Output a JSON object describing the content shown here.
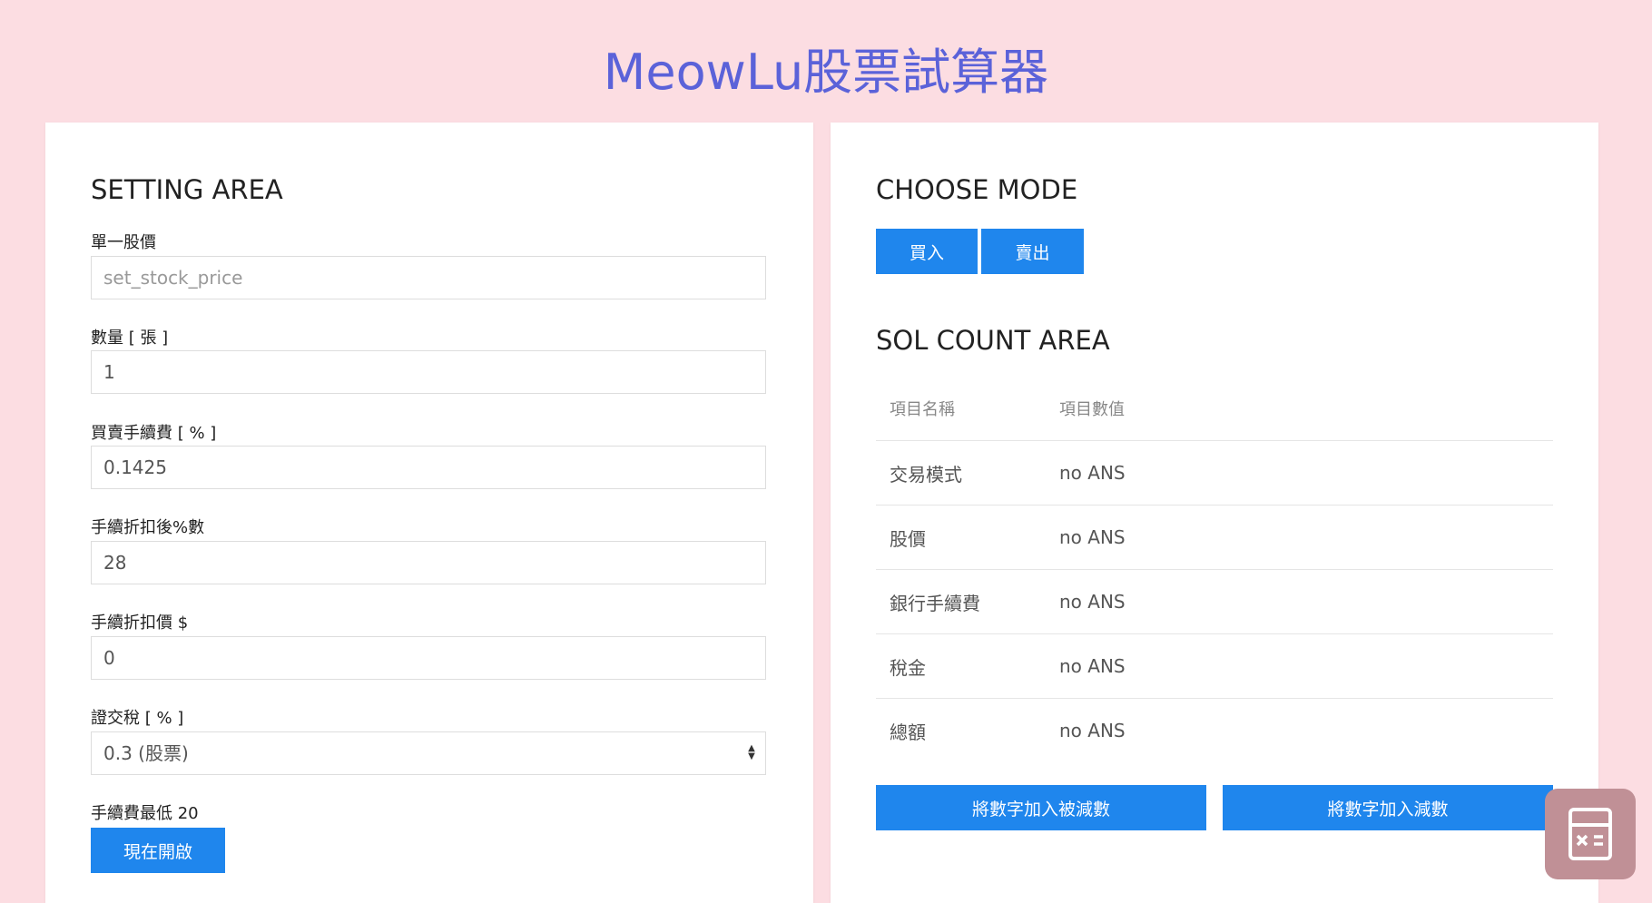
{
  "page": {
    "title": "MeowLu股票試算器"
  },
  "setting": {
    "heading": "SETTING AREA",
    "price_label": "單一股價",
    "price_placeholder": "set_stock_price",
    "qty_label": "數量 [ 張 ]",
    "qty_value": "1",
    "fee_label": "買賣手續費 [ % ]",
    "fee_value": "0.1425",
    "discount_label": "手續折扣後%數",
    "discount_value": "28",
    "discount_price_label": "手續折扣價 $",
    "discount_price_value": "0",
    "tax_label": "證交稅 [ % ]",
    "tax_value": "0.3 (股票)",
    "min_fee_label": "手續費最低 20",
    "open_button": "現在開啟"
  },
  "mode": {
    "heading": "CHOOSE MODE",
    "buy": "買入",
    "sell": "賣出"
  },
  "sol": {
    "heading": "SOL COUNT AREA",
    "col_name": "項目名稱",
    "col_value": "項目數值",
    "rows": [
      {
        "name": "交易模式",
        "value": "no ANS"
      },
      {
        "name": "股價",
        "value": "no ANS"
      },
      {
        "name": "銀行手續費",
        "value": "no ANS"
      },
      {
        "name": "稅金",
        "value": "no ANS"
      },
      {
        "name": "總額",
        "value": "no ANS"
      }
    ],
    "add_minuend": "將數字加入被減數",
    "add_subtrahend": "將數字加入減數"
  },
  "fab": {
    "icon": "calculator-icon"
  },
  "colors": {
    "background": "#fcdde2",
    "title": "#5b62d9",
    "button": "#1f86ed",
    "fab": "#c09096"
  }
}
